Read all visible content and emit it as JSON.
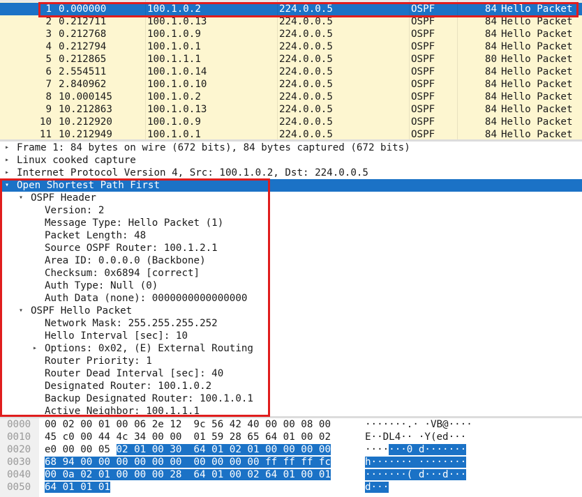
{
  "packets": [
    {
      "no": "1",
      "time": "0.000000",
      "src": "100.1.0.2",
      "dst": "224.0.0.5",
      "proto": "OSPF",
      "len": "84",
      "info": "Hello Packet",
      "selected": true
    },
    {
      "no": "2",
      "time": "0.212711",
      "src": "100.1.0.13",
      "dst": "224.0.0.5",
      "proto": "OSPF",
      "len": "84",
      "info": "Hello Packet"
    },
    {
      "no": "3",
      "time": "0.212768",
      "src": "100.1.0.9",
      "dst": "224.0.0.5",
      "proto": "OSPF",
      "len": "84",
      "info": "Hello Packet"
    },
    {
      "no": "4",
      "time": "0.212794",
      "src": "100.1.0.1",
      "dst": "224.0.0.5",
      "proto": "OSPF",
      "len": "84",
      "info": "Hello Packet"
    },
    {
      "no": "5",
      "time": "0.212865",
      "src": "100.1.1.1",
      "dst": "224.0.0.5",
      "proto": "OSPF",
      "len": "80",
      "info": "Hello Packet"
    },
    {
      "no": "6",
      "time": "2.554511",
      "src": "100.1.0.14",
      "dst": "224.0.0.5",
      "proto": "OSPF",
      "len": "84",
      "info": "Hello Packet"
    },
    {
      "no": "7",
      "time": "2.840962",
      "src": "100.1.0.10",
      "dst": "224.0.0.5",
      "proto": "OSPF",
      "len": "84",
      "info": "Hello Packet"
    },
    {
      "no": "8",
      "time": "10.000145",
      "src": "100.1.0.2",
      "dst": "224.0.0.5",
      "proto": "OSPF",
      "len": "84",
      "info": "Hello Packet"
    },
    {
      "no": "9",
      "time": "10.212863",
      "src": "100.1.0.13",
      "dst": "224.0.0.5",
      "proto": "OSPF",
      "len": "84",
      "info": "Hello Packet"
    },
    {
      "no": "10",
      "time": "10.212920",
      "src": "100.1.0.9",
      "dst": "224.0.0.5",
      "proto": "OSPF",
      "len": "84",
      "info": "Hello Packet"
    },
    {
      "no": "11",
      "time": "10.212949",
      "src": "100.1.0.1",
      "dst": "224.0.0.5",
      "proto": "OSPF",
      "len": "84",
      "info": "Hello Packet"
    }
  ],
  "details": [
    {
      "text": "Frame 1: 84 bytes on wire (672 bits), 84 bytes captured (672 bits)",
      "level": 0,
      "arrow": "collapsed"
    },
    {
      "text": "Linux cooked capture",
      "level": 0,
      "arrow": "collapsed"
    },
    {
      "text": "Internet Protocol Version 4, Src: 100.1.0.2, Dst: 224.0.0.5",
      "level": 0,
      "arrow": "collapsed"
    },
    {
      "text": "Open Shortest Path First",
      "level": 0,
      "arrow": "expanded",
      "selected": true
    },
    {
      "text": "OSPF Header",
      "level": 1,
      "arrow": "expanded"
    },
    {
      "text": "Version: 2",
      "level": 2,
      "arrow": "none"
    },
    {
      "text": "Message Type: Hello Packet (1)",
      "level": 2,
      "arrow": "none"
    },
    {
      "text": "Packet Length: 48",
      "level": 2,
      "arrow": "none"
    },
    {
      "text": "Source OSPF Router: 100.1.2.1",
      "level": 2,
      "arrow": "none"
    },
    {
      "text": "Area ID: 0.0.0.0 (Backbone)",
      "level": 2,
      "arrow": "none"
    },
    {
      "text": "Checksum: 0x6894 [correct]",
      "level": 2,
      "arrow": "none"
    },
    {
      "text": "Auth Type: Null (0)",
      "level": 2,
      "arrow": "none"
    },
    {
      "text": "Auth Data (none): 0000000000000000",
      "level": 2,
      "arrow": "none"
    },
    {
      "text": "OSPF Hello Packet",
      "level": 1,
      "arrow": "expanded"
    },
    {
      "text": "Network Mask: 255.255.255.252",
      "level": 2,
      "arrow": "none"
    },
    {
      "text": "Hello Interval [sec]: 10",
      "level": 2,
      "arrow": "none"
    },
    {
      "text": "Options: 0x02, (E) External Routing",
      "level": 2,
      "arrow": "collapsed"
    },
    {
      "text": "Router Priority: 1",
      "level": 2,
      "arrow": "none"
    },
    {
      "text": "Router Dead Interval [sec]: 40",
      "level": 2,
      "arrow": "none"
    },
    {
      "text": "Designated Router: 100.1.0.2",
      "level": 2,
      "arrow": "none"
    },
    {
      "text": "Backup Designated Router: 100.1.0.1",
      "level": 2,
      "arrow": "none"
    },
    {
      "text": "Active Neighbor: 100.1.1.1",
      "level": 2,
      "arrow": "none"
    }
  ],
  "bytes": [
    {
      "offset": "0000",
      "hex": [
        [
          "00 02 00 01 00 06 2e 12  9c 56 42 40 00 00 08 00",
          false
        ]
      ],
      "ascii": [
        [
          "·······.· ·VB@····",
          false
        ]
      ]
    },
    {
      "offset": "0010",
      "hex": [
        [
          "45 c0 00 44 4c 34 00 00  01 59 28 65 64 01 00 02",
          false
        ]
      ],
      "ascii": [
        [
          "E··DL4·· ·Y(ed···",
          false
        ]
      ]
    },
    {
      "offset": "0020",
      "hex": [
        [
          "e0 00 00 05 ",
          false
        ],
        [
          "02 01 00 30  64 01 02 01 00 00 00 00",
          true
        ]
      ],
      "ascii": [
        [
          "····",
          false
        ],
        [
          "···0 d·······",
          true
        ]
      ]
    },
    {
      "offset": "0030",
      "hex": [
        [
          "68 94 00 00 00 00 00 00  00 00 00 00 ff ff ff fc",
          true
        ]
      ],
      "ascii": [
        [
          "h······· ········",
          true
        ]
      ]
    },
    {
      "offset": "0040",
      "hex": [
        [
          "00 0a 02 01 00 00 00 28  64 01 00 02 64 01 00 01",
          true
        ]
      ],
      "ascii": [
        [
          "·······( d···d···",
          true
        ]
      ]
    },
    {
      "offset": "0050",
      "hex": [
        [
          "64 01 01 01",
          true
        ]
      ],
      "ascii": [
        [
          "d···",
          true
        ]
      ]
    }
  ],
  "colors": {
    "selection": "#1b72c6",
    "packet_bg": "#fdf6d0",
    "annotation": "#e01d1d"
  }
}
